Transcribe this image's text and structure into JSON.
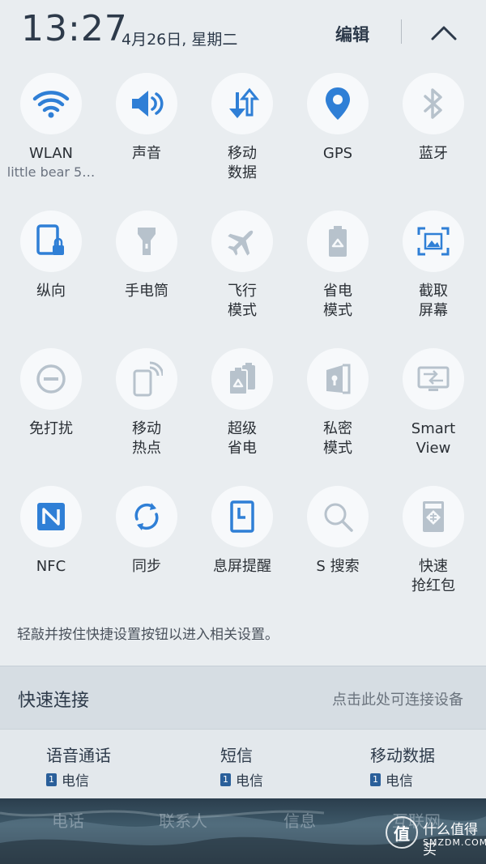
{
  "header": {
    "time": "13:27",
    "date": "4月26日, 星期二",
    "edit_label": "编辑"
  },
  "tiles": [
    {
      "label": "WLAN",
      "sub": "little bear 5…",
      "icon": "wifi-icon",
      "active": true
    },
    {
      "label": "声音",
      "icon": "speaker-icon",
      "active": true
    },
    {
      "label": "移动\n数据",
      "icon": "mobile-data-icon",
      "active": true
    },
    {
      "label": "GPS",
      "icon": "location-pin-icon",
      "active": true
    },
    {
      "label": "蓝牙",
      "icon": "bluetooth-icon",
      "active": false
    },
    {
      "label": "纵向",
      "icon": "portrait-lock-icon",
      "active": true
    },
    {
      "label": "手电筒",
      "icon": "flashlight-icon",
      "active": false
    },
    {
      "label": "飞行\n模式",
      "icon": "airplane-icon",
      "active": false
    },
    {
      "label": "省电\n模式",
      "icon": "battery-recycle-icon",
      "active": false
    },
    {
      "label": "截取\n屏幕",
      "icon": "screenshot-icon",
      "active": true
    },
    {
      "label": "免打扰",
      "icon": "do-not-disturb-icon",
      "active": false
    },
    {
      "label": "移动\n热点",
      "icon": "hotspot-icon",
      "active": false
    },
    {
      "label": "超级\n省电",
      "icon": "ultra-power-saving-icon",
      "active": false
    },
    {
      "label": "私密\n模式",
      "icon": "private-mode-icon",
      "active": false
    },
    {
      "label": "Smart\nView",
      "icon": "smart-view-icon",
      "active": false
    },
    {
      "label": "NFC",
      "icon": "nfc-icon",
      "active": true
    },
    {
      "label": "同步",
      "icon": "sync-icon",
      "active": true
    },
    {
      "label": "息屏提醒",
      "icon": "always-on-display-icon",
      "active": true
    },
    {
      "label": "S 搜索",
      "icon": "search-icon",
      "active": false
    },
    {
      "label": "快速\n抢红包",
      "icon": "red-envelope-icon",
      "active": false
    }
  ],
  "hint": "轻敲并按住快捷设置按钮以进入相关设置。",
  "quick_connect": {
    "title": "快速连接",
    "link": "点击此处可连接设备"
  },
  "sim": [
    {
      "title": "语音通话",
      "carrier": "电信",
      "slot": "1"
    },
    {
      "title": "短信",
      "carrier": "电信",
      "slot": "1"
    },
    {
      "title": "移动数据",
      "carrier": "电信",
      "slot": "1"
    }
  ],
  "bottom": {
    "tabs": [
      "电话",
      "联系人",
      "信息",
      "互联网"
    ],
    "watermark": "什么值得买",
    "watermark_sub": "SMZDM.COM",
    "watermark_glyph": "值"
  },
  "colors": {
    "active_icon": "#2f7fd6",
    "inactive_icon": "#b7c2cc",
    "tile_bg": "#f7f9fb",
    "panel_bg": "#e9edf0"
  }
}
